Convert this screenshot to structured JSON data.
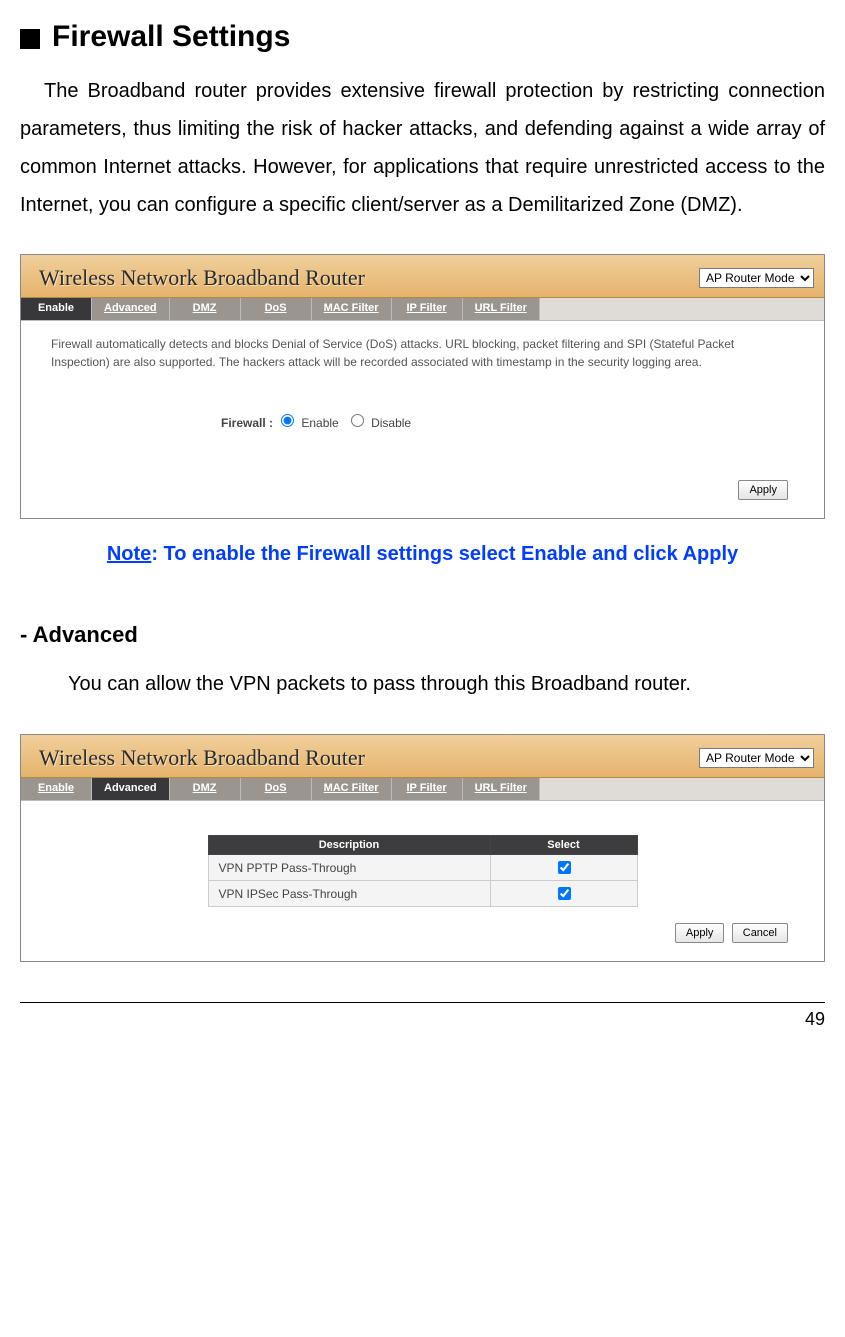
{
  "doc": {
    "heading": "Firewall Settings",
    "intro": "The Broadband router provides extensive firewall protection by restricting connection parameters, thus limiting the risk of hacker attacks, and defending against a wide array of common Internet attacks. However, for applications that require unrestricted access to the Internet, you can configure a specific client/server as a Demilitarized Zone (DMZ).",
    "note_word": "Note",
    "note_rest": ": To enable the Firewall settings select Enable and click Apply",
    "sub_heading": "- Advanced",
    "sub_intro": "You can allow the VPN packets to pass through this Broadband router.",
    "page_number": "49"
  },
  "router": {
    "title": "Wireless Network Broadband Router",
    "mode": "AP Router Mode",
    "tabs": [
      "Enable",
      "Advanced",
      "DMZ",
      "DoS",
      "MAC Filter",
      "IP Filter",
      "URL Filter"
    ],
    "panel1": {
      "active_tab_index": 0,
      "desc": "Firewall automatically detects and blocks Denial of Service (DoS) attacks. URL blocking, packet filtering and SPI (Stateful Packet Inspection) are also supported. The hackers attack will be recorded associated with timestamp in the security logging area.",
      "field_label": "Firewall :",
      "opt_enable": "Enable",
      "opt_disable": "Disable",
      "btn_apply": "Apply"
    },
    "panel2": {
      "active_tab_index": 1,
      "th_desc": "Description",
      "th_select": "Select",
      "rows": [
        {
          "desc": "VPN PPTP Pass-Through",
          "checked": true
        },
        {
          "desc": "VPN IPSec Pass-Through",
          "checked": true
        }
      ],
      "btn_apply": "Apply",
      "btn_cancel": "Cancel"
    }
  }
}
